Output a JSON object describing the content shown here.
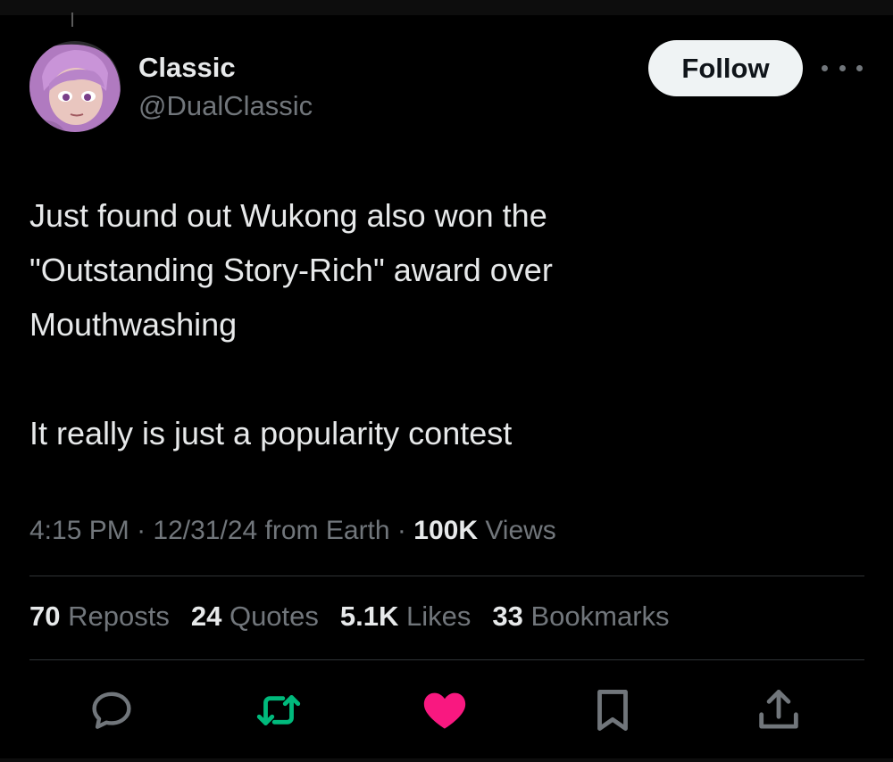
{
  "author": {
    "display_name": "Classic",
    "handle": "@DualClassic"
  },
  "follow_button": {
    "label": "Follow"
  },
  "tweet": {
    "lines_para1": [
      "Just found out Wukong also won the",
      "\"Outstanding Story-Rich\" award over",
      "Mouthwashing"
    ],
    "para2": "It really is just a popularity contest"
  },
  "meta": {
    "time": "4:15 PM",
    "date_source": "12/31/24 from Earth",
    "separator": "·",
    "views_count": "100K",
    "views_label": "Views"
  },
  "stats": {
    "reposts": {
      "count": "70",
      "label": "Reposts"
    },
    "quotes": {
      "count": "24",
      "label": "Quotes"
    },
    "likes": {
      "count": "5.1K",
      "label": "Likes"
    },
    "bookmarks": {
      "count": "33",
      "label": "Bookmarks"
    }
  },
  "actions": [
    {
      "icon": "reply-icon",
      "color": "#71767b"
    },
    {
      "icon": "repost-icon",
      "color": "#00ba7c"
    },
    {
      "icon": "like-icon",
      "color": "#f91880",
      "liked": true
    },
    {
      "icon": "bookmark-icon",
      "color": "#71767b"
    },
    {
      "icon": "share-icon",
      "color": "#71767b"
    }
  ],
  "colors": {
    "background": "#000000",
    "text_primary": "#e7e9ea",
    "text_secondary": "#71767b",
    "repost_green": "#00ba7c",
    "like_pink": "#f91880",
    "follow_bg": "#eff3f4"
  }
}
